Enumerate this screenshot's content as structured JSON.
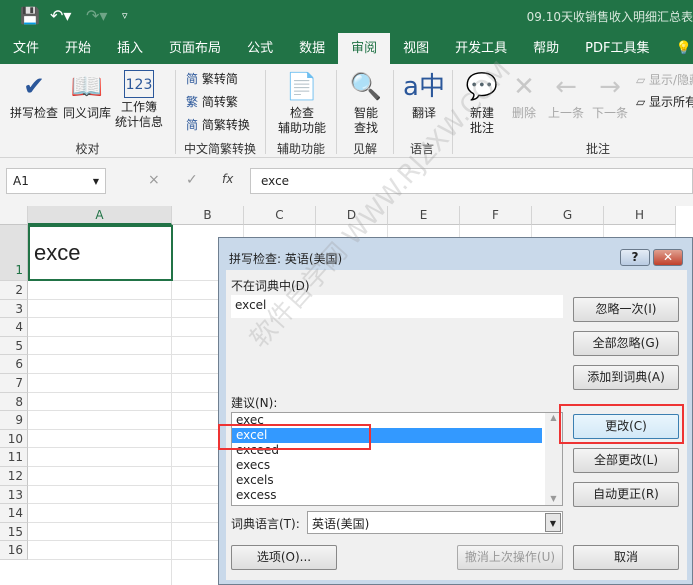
{
  "title": "09.10天收销售收入明细汇总表",
  "quick_access": {
    "save": "save-icon",
    "undo": "undo-icon",
    "redo": "redo-icon",
    "customize": "customize-icon"
  },
  "tabs": [
    "文件",
    "开始",
    "插入",
    "页面布局",
    "公式",
    "数据",
    "审阅",
    "视图",
    "开发工具",
    "帮助",
    "PDF工具集"
  ],
  "active_tab": "审阅",
  "ribbon": {
    "spell": "拼写检查",
    "thesaurus": "同义词库",
    "stats1": "工作簿",
    "stats2": "统计信息",
    "g_proof": "校对",
    "t2s": "繁转简",
    "s2t": "简转繁",
    "conv": "简繁转换",
    "g_chinese": "中文简繁转换",
    "acc1": "检查",
    "acc2": "辅助功能",
    "g_acc": "辅助功能",
    "smart1": "智能",
    "smart2": "查找",
    "g_insight": "见解",
    "translate": "翻译",
    "g_lang": "语言",
    "new1": "新建",
    "new2": "批注",
    "delete": "删除",
    "prev": "上一条",
    "next": "下一条",
    "show1": "显示/隐藏批注",
    "show2": "显示所有批注",
    "g_comment": "批注"
  },
  "formula_bar": {
    "name_box": "A1",
    "cancel": "×",
    "enter": "✓",
    "fx": "fx",
    "value": "exce"
  },
  "sheet": {
    "columns": [
      "A",
      "B",
      "C",
      "D",
      "E",
      "F",
      "G",
      "H"
    ],
    "rows": [
      "1",
      "2",
      "3",
      "4",
      "5",
      "6",
      "7",
      "8",
      "9",
      "10",
      "11",
      "12",
      "13",
      "14",
      "15",
      "16"
    ],
    "a1": "exce"
  },
  "dialog": {
    "title": "拼写检查: 英语(美国)",
    "help": "?",
    "close": "✕",
    "not_in_dict_label": "不在词典中(D)",
    "not_in_dict": "excel",
    "suggest_label": "建议(N):",
    "suggestions": [
      "exec",
      "excel",
      "exceed",
      "execs",
      "excels",
      "excess"
    ],
    "selected": "excel",
    "lang_label": "词典语言(T):",
    "lang": "英语(美国)",
    "ignore_once": "忽略一次(I)",
    "ignore_all": "全部忽略(G)",
    "add": "添加到词典(A)",
    "change": "更改(C)",
    "change_all": "全部更改(L)",
    "autocorrect": "自动更正(R)",
    "options": "选项(O)...",
    "undo_last": "撤消上次操作(U)",
    "cancel": "取消"
  },
  "watermark": "软件自学网 WWW.RJZXW.COM",
  "colors": {
    "excel_green": "#217346",
    "highlight": "#ee3333",
    "selection": "#3399ff"
  }
}
